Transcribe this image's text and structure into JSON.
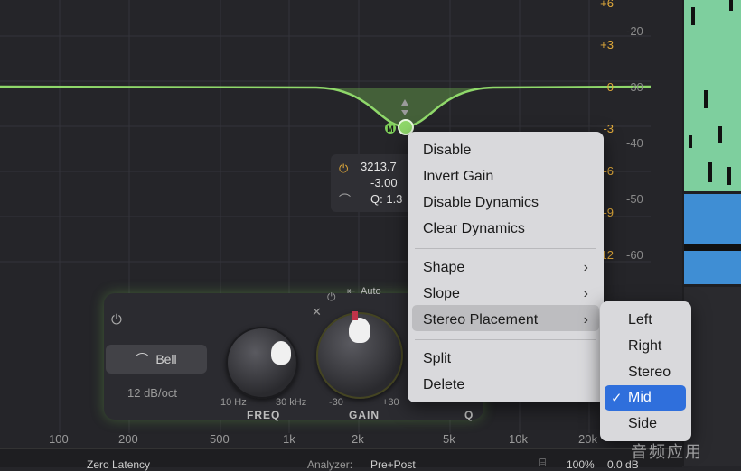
{
  "db_scale_left": [
    "+6",
    "+3",
    "0",
    "-3",
    "-6",
    "-9",
    "-12"
  ],
  "db_scale_right": [
    "-20",
    "-30",
    "-40",
    "-50",
    "-60"
  ],
  "freq_labels": [
    "100",
    "200",
    "500",
    "1k",
    "2k",
    "5k",
    "10k",
    "20k"
  ],
  "band_point": {
    "label": "M"
  },
  "tooltip": {
    "freq": "3213.7",
    "gain": "-3.00",
    "q": "Q: 1.3"
  },
  "panel": {
    "shape_button": "Bell",
    "slope": "12 dB/oct",
    "freq_label": "FREQ",
    "freq_min": "10 Hz",
    "freq_max": "30 kHz",
    "gain_label": "GAIN",
    "gain_min": "-30",
    "gain_max": "+30",
    "q_label": "Q",
    "auto_label": "Auto"
  },
  "context_menu": {
    "items": [
      "Disable",
      "Invert Gain",
      "Disable Dynamics",
      "Clear Dynamics"
    ],
    "items2": [
      "Shape",
      "Slope",
      "Stereo Placement"
    ],
    "items3": [
      "Split",
      "Delete"
    ],
    "highlighted": "Stereo Placement"
  },
  "submenu": {
    "items": [
      "Left",
      "Right",
      "Stereo",
      "Mid",
      "Side"
    ],
    "selected": "Mid",
    "check": "✓"
  },
  "status_bar": {
    "latency": "Zero Latency",
    "analyzer_label": "Analyzer:",
    "analyzer_value": "Pre+Post",
    "zoom": "100%",
    "gain": "0.0 dB"
  },
  "watermark": "音频应用",
  "colors": {
    "accent_green": "#7ecf5a",
    "db_orange": "#e0a93a",
    "selection_blue": "#2f6fdc"
  }
}
